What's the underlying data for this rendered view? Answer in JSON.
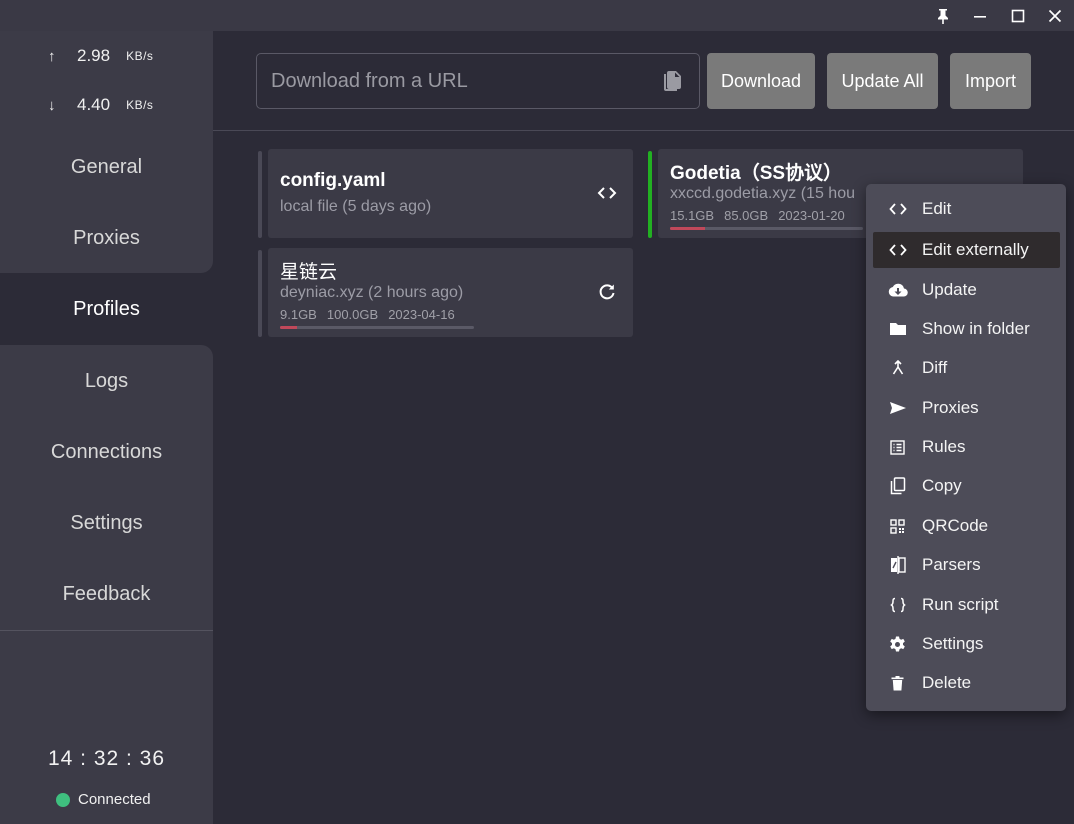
{
  "window": {
    "pin_icon": "pin-icon",
    "minimize_icon": "minimize-icon",
    "maximize_icon": "maximize-icon",
    "close_icon": "close-icon"
  },
  "traffic": {
    "upload_arrow": "↑",
    "upload_value": "2.98",
    "upload_unit": "KB/s",
    "download_arrow": "↓",
    "download_value": "4.40",
    "download_unit": "KB/s"
  },
  "nav": {
    "items": [
      {
        "label": "General"
      },
      {
        "label": "Proxies"
      },
      {
        "label": "Profiles",
        "active": true
      },
      {
        "label": "Logs"
      },
      {
        "label": "Connections"
      },
      {
        "label": "Settings"
      },
      {
        "label": "Feedback"
      }
    ]
  },
  "clock": "14 : 32 : 36",
  "connection": {
    "status": "Connected",
    "color": "#3fbf7f"
  },
  "toolbar": {
    "url_placeholder": "Download from a URL",
    "download": "Download",
    "update_all": "Update All",
    "import": "Import"
  },
  "profiles": [
    {
      "name": "config.yaml",
      "subtitle": "local file (5 days ago)",
      "action_icon": "code-icon"
    },
    {
      "name": "Godetia（SS协议）",
      "subtitle": "xxccd.godetia.xyz (15 hou",
      "upload": "15.1GB",
      "total": "85.0GB",
      "expire": "2023-01-20",
      "usage_fraction": 0.18,
      "selected": true,
      "accent": "#22b022"
    },
    {
      "name": "星链云",
      "subtitle": "deyniac.xyz (2 hours ago)",
      "upload": "9.1GB",
      "total": "100.0GB",
      "expire": "2023-04-16",
      "usage_fraction": 0.09,
      "action_icon": "refresh-icon"
    }
  ],
  "context_menu": {
    "items": [
      {
        "label": "Edit",
        "icon": "code-icon"
      },
      {
        "label": "Edit externally",
        "icon": "code-icon",
        "highlighted": true
      },
      {
        "label": "Update",
        "icon": "cloud-download-icon"
      },
      {
        "label": "Show in folder",
        "icon": "folder-icon"
      },
      {
        "label": "Diff",
        "icon": "merge-icon"
      },
      {
        "label": "Proxies",
        "icon": "send-icon"
      },
      {
        "label": "Rules",
        "icon": "list-icon"
      },
      {
        "label": "Copy",
        "icon": "copy-icon"
      },
      {
        "label": "QRCode",
        "icon": "qrcode-icon"
      },
      {
        "label": "Parsers",
        "icon": "compare-icon"
      },
      {
        "label": "Run script",
        "icon": "braces-icon"
      },
      {
        "label": "Settings",
        "icon": "gear-icon"
      },
      {
        "label": "Delete",
        "icon": "trash-icon"
      }
    ]
  }
}
